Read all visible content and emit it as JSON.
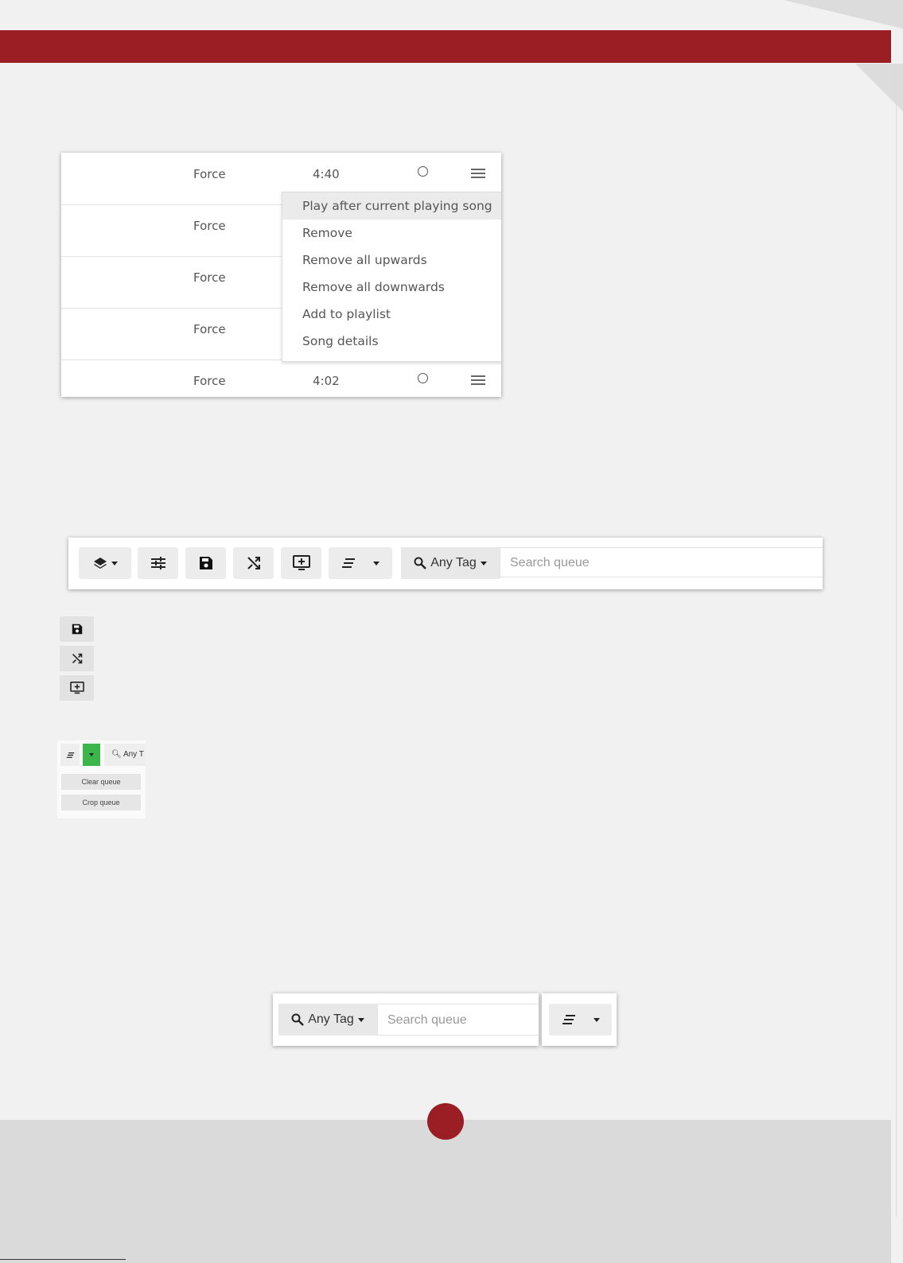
{
  "queue_table": {
    "rows": [
      {
        "artist": "Force",
        "duration": "4:40"
      },
      {
        "artist": "Force",
        "duration": ""
      },
      {
        "artist": "Force",
        "duration": ""
      },
      {
        "artist": "Force",
        "duration": ""
      },
      {
        "artist": "Force",
        "duration": "4:02"
      }
    ],
    "context_menu": [
      "Play after current playing song",
      "Remove",
      "Remove all upwards",
      "Remove all downwards",
      "Add to playlist",
      "Song details"
    ]
  },
  "toolbar": {
    "search_tag_label": "Any Tag",
    "search_placeholder": "Search queue",
    "icons": [
      "layers-icon",
      "sliders-icon",
      "save-icon",
      "shuffle-icon",
      "add-to-screen-icon",
      "sort-icon"
    ]
  },
  "queue_dropdown": {
    "search_label": "Any T",
    "items": [
      "Clear queue",
      "Crop queue"
    ],
    "accent": "#3cb54a"
  },
  "search_bar": {
    "tag_label": "Any Tag",
    "placeholder": "Search queue"
  },
  "colors": {
    "brand_red": "#9a1e24",
    "footer_gray": "#dadada"
  }
}
